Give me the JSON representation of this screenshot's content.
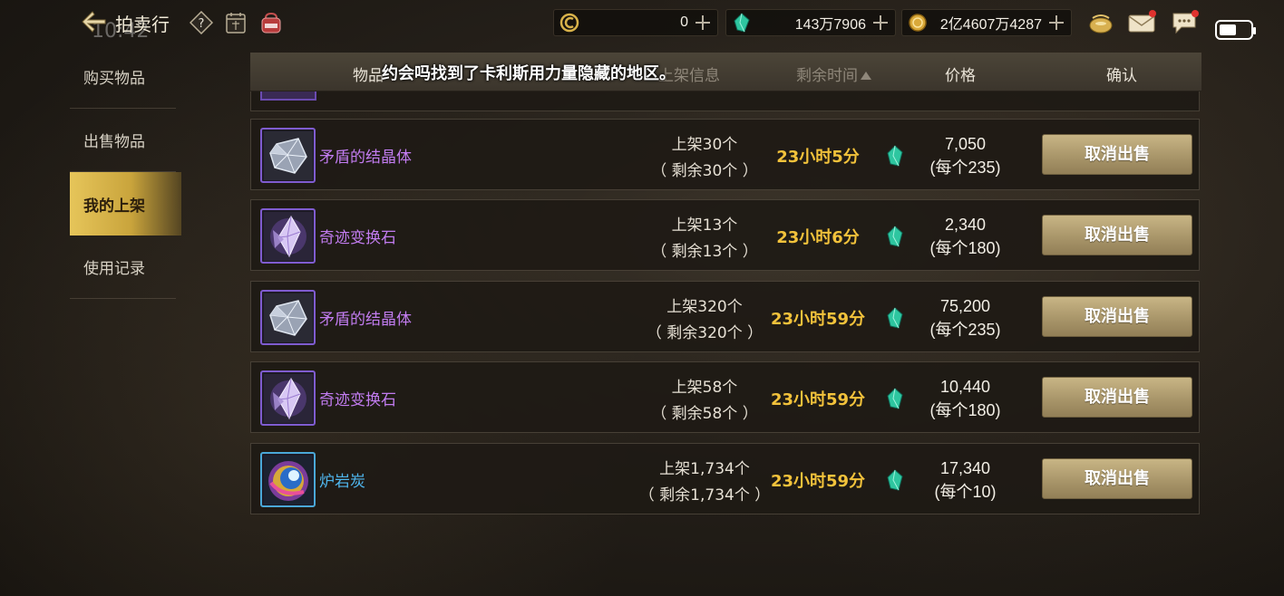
{
  "status_bar": {
    "time": "10:42"
  },
  "header": {
    "title": "拍卖行",
    "resources": [
      {
        "icon": "coin-c-icon",
        "value": "0"
      },
      {
        "icon": "green-gem-icon",
        "value": "143万7906"
      },
      {
        "icon": "gold-coin-icon",
        "value": "2亿4607万4287"
      }
    ]
  },
  "sidebar": {
    "items": [
      {
        "label": "购买物品"
      },
      {
        "label": "出售物品"
      },
      {
        "label": "我的上架"
      },
      {
        "label": "使用记录"
      }
    ],
    "active_index": 2
  },
  "table": {
    "columns": {
      "item": "物品",
      "info": "上架信息",
      "time": "剩余时间",
      "price": "价格",
      "confirm": "确认"
    },
    "notice": "约会吗找到了卡利斯用力量隐藏的地区。",
    "rows": [
      {
        "name": "矛盾的结晶体",
        "rarity": "purple",
        "icon": "crystal-icon",
        "listed": "上架30个",
        "remaining": "（ 剩余30个 ）",
        "time": "23小时5分",
        "price_total": "7,050",
        "price_each": "(每个235)",
        "action": "取消出售"
      },
      {
        "name": "奇迹变换石",
        "rarity": "purple",
        "icon": "purple-stone-icon",
        "listed": "上架13个",
        "remaining": "（ 剩余13个 ）",
        "time": "23小时6分",
        "price_total": "2,340",
        "price_each": "(每个180)",
        "action": "取消出售"
      },
      {
        "name": "矛盾的结晶体",
        "rarity": "purple",
        "icon": "crystal-icon",
        "listed": "上架320个",
        "remaining": "（ 剩余320个 ）",
        "time": "23小时59分",
        "price_total": "75,200",
        "price_each": "(每个235)",
        "action": "取消出售"
      },
      {
        "name": "奇迹变换石",
        "rarity": "purple",
        "icon": "purple-stone-icon",
        "listed": "上架58个",
        "remaining": "（ 剩余58个 ）",
        "time": "23小时59分",
        "price_total": "10,440",
        "price_each": "(每个180)",
        "action": "取消出售"
      },
      {
        "name": "炉岩炭",
        "rarity": "blue",
        "icon": "furnace-coal-icon",
        "listed": "上架1,734个",
        "remaining": "（ 剩余1,734个 ）",
        "time": "23小时59分",
        "price_total": "17,340",
        "price_each": "(每个10)",
        "action": "取消出售"
      }
    ]
  },
  "colors": {
    "accent_gold": "#e6c55a",
    "time_text": "#f2c23b",
    "rarity_purple": "#c27cf0",
    "rarity_blue": "#4fb6ee"
  }
}
